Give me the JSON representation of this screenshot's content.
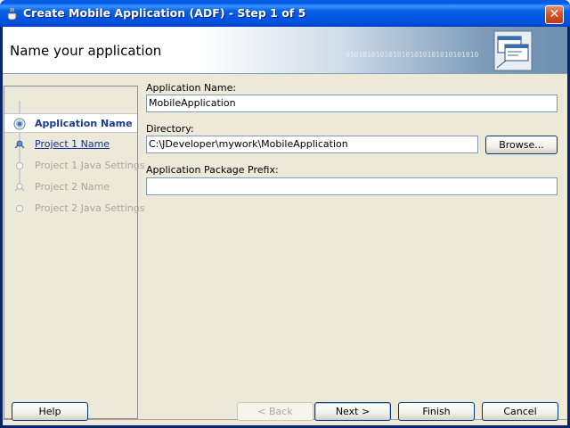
{
  "window": {
    "title": "Create Mobile Application (ADF) - Step 1 of 5",
    "close_symbol": "✕"
  },
  "banner": {
    "title": "Name your application",
    "binary_text": "0101010101010101010101010101010",
    "binary_text_2": "01010101010"
  },
  "steps": [
    {
      "label": "Application Name",
      "state": "active"
    },
    {
      "label": "Project 1 Name",
      "state": "link"
    },
    {
      "label": "Project 1 Java Settings",
      "state": "disabled"
    },
    {
      "label": "Project 2 Name",
      "state": "disabled"
    },
    {
      "label": "Project 2 Java Settings",
      "state": "disabled"
    }
  ],
  "form": {
    "app_name_label": "Application Name:",
    "app_name_value": "MobileApplication",
    "directory_label": "Directory:",
    "directory_value": "C:\\JDeveloper\\mywork\\MobileApplication",
    "browse_label": "Browse...",
    "package_label": "Application Package Prefix:",
    "package_value": ""
  },
  "buttons": {
    "help": "Help",
    "back": "< Back",
    "next": "Next >",
    "finish": "Finish",
    "cancel": "Cancel"
  },
  "colors": {
    "titlebar": "#0055e5",
    "active_step_text": "#1a3a8c",
    "link_text": "#0a2f9c",
    "disabled_text": "#a7a69b"
  }
}
